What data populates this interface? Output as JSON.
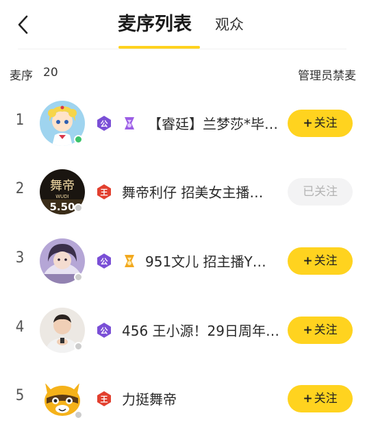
{
  "header": {
    "tabs": [
      {
        "label": "麦序列表",
        "active": true
      },
      {
        "label": "观众",
        "active": false
      }
    ]
  },
  "summary": {
    "label": "麦序",
    "count": "20",
    "admin_action": "管理员禁麦"
  },
  "colors": {
    "accent": "#ffd21e",
    "online": "#3cc36b",
    "offline": "#cccccc",
    "badge_purple": "#7a4fd6",
    "badge_red": "#e2402f"
  },
  "rows": [
    {
      "rank": "1",
      "name": "【睿廷】兰梦莎*毕…",
      "status": "online",
      "badges": [
        "公",
        "medal-purple"
      ],
      "follow_label": "关注",
      "follow_plus": "+",
      "followed": false
    },
    {
      "rank": "2",
      "name": "舞帝利仔  招美女主播…",
      "status": "offline",
      "badges": [
        "王"
      ],
      "follow_label": "已关注",
      "follow_plus": "",
      "followed": true
    },
    {
      "rank": "3",
      "name": "951文儿  招主播Y…",
      "status": "offline",
      "badges": [
        "公",
        "medal-gold"
      ],
      "follow_label": "关注",
      "follow_plus": "+",
      "followed": false
    },
    {
      "rank": "4",
      "name": "456 王小源！29日周年…",
      "status": "offline",
      "badges": [
        "公"
      ],
      "follow_label": "关注",
      "follow_plus": "+",
      "followed": false
    },
    {
      "rank": "5",
      "name": "力挺舞帝",
      "status": "offline",
      "badges": [
        "王"
      ],
      "follow_label": "关注",
      "follow_plus": "+",
      "followed": false
    }
  ],
  "avatar_text": {
    "row2_line1": "舞帝",
    "row2_line2": "WUDI",
    "row2_line3": "5.50"
  }
}
